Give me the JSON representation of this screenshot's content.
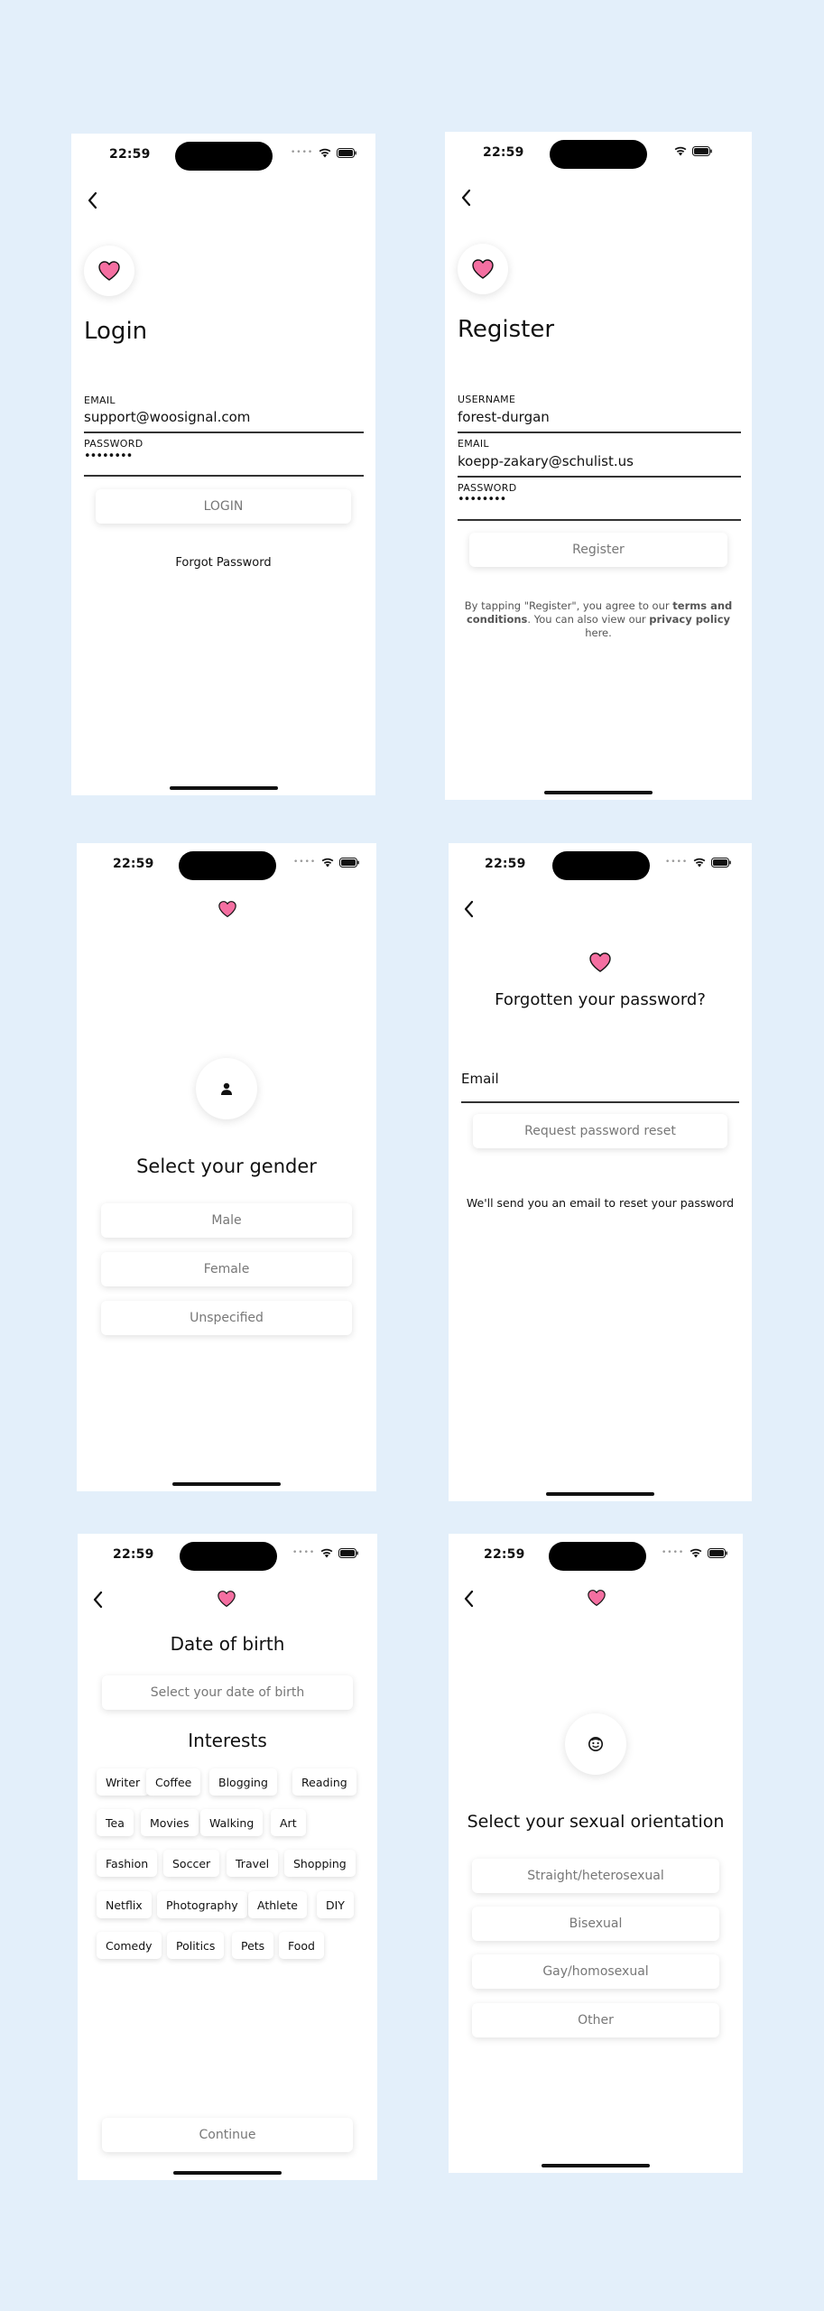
{
  "status_time": "22:59",
  "login": {
    "title": "Login",
    "email_label": "EMAIL",
    "email_value": "support@woosignal.com",
    "password_label": "PASSWORD",
    "password_value": "••••••••",
    "login_button": "LOGIN",
    "forgot_link": "Forgot Password"
  },
  "register": {
    "title": "Register",
    "username_label": "USERNAME",
    "username_value": "forest-durgan",
    "email_label": "EMAIL",
    "email_value": "koepp-zakary@schulist.us",
    "password_label": "PASSWORD",
    "password_value": "••••••••",
    "register_button": "Register",
    "terms_prefix": "By tapping \"Register\", you agree to our ",
    "terms_link": "terms and conditions",
    "terms_mid": ". You can also view our ",
    "privacy_link": "privacy policy",
    "terms_suffix": " here."
  },
  "gender": {
    "title": "Select your gender",
    "options": [
      "Male",
      "Female",
      "Unspecified"
    ]
  },
  "forgot": {
    "title": "Forgotten your password?",
    "email_placeholder": "Email",
    "reset_button": "Request password reset",
    "info": "We'll send you an email to reset your password"
  },
  "dob": {
    "title": "Date of birth",
    "date_placeholder": "Select your date of birth",
    "interests_title": "Interests",
    "interests": [
      "Writer",
      "Coffee",
      "Blogging",
      "Reading",
      "Tea",
      "Movies",
      "Walking",
      "Art",
      "Fashion",
      "Soccer",
      "Travel",
      "Shopping",
      "Netflix",
      "Photography",
      "Athlete",
      "DIY",
      "Comedy",
      "Politics",
      "Pets",
      "Food"
    ],
    "continue_button": "Continue"
  },
  "orientation": {
    "title": "Select your sexual orientation",
    "options": [
      "Straight/heterosexual",
      "Bisexual",
      "Gay/homosexual",
      "Other"
    ]
  },
  "colors": {
    "heart": "#f46fa1",
    "background": "#e3effa"
  }
}
